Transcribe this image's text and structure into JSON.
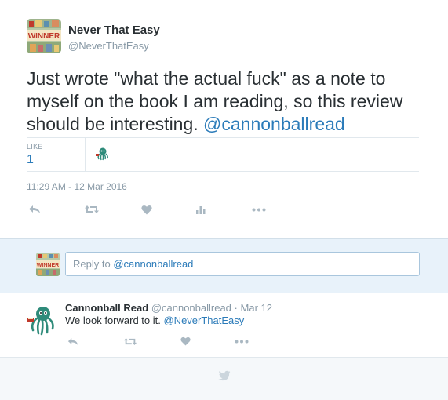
{
  "main_tweet": {
    "author_name": "Never That Easy",
    "author_handle": "@NeverThatEasy",
    "avatar_text": "WINNER",
    "text_before_mention": "Just wrote \"what the actual fuck\" as a note to myself on the book I am reading, so this review should be interesting. ",
    "text_mention": "@cannonballread",
    "stats": {
      "like_label": "LIKE",
      "like_count": "1"
    },
    "timestamp": "11:29 AM - 12 Mar 2016",
    "actions": [
      "reply-icon",
      "retweet-icon",
      "like-icon",
      "analytics-icon",
      "more-icon"
    ]
  },
  "reply_box": {
    "placeholder_prefix": "Reply to ",
    "placeholder_mention": "@cannonballread",
    "avatar_text": "WINNER"
  },
  "reply_tweet": {
    "author_name": "Cannonball Read",
    "author_handle": "@cannonballread",
    "separator": "·",
    "date": "Mar 12",
    "text_before_mention": "We look forward to it. ",
    "text_mention": "@NeverThatEasy",
    "actions": [
      "reply-icon",
      "retweet-icon",
      "like-icon",
      "more-icon"
    ]
  },
  "footer": {
    "icon": "twitter-bird-icon"
  },
  "colors": {
    "accent": "#2b7bb9",
    "text": "#292f33",
    "muted": "#8899a6",
    "icon": "#aab8c2",
    "reply_bg": "#e8f2fa",
    "octopus": "#2e8b7a"
  }
}
